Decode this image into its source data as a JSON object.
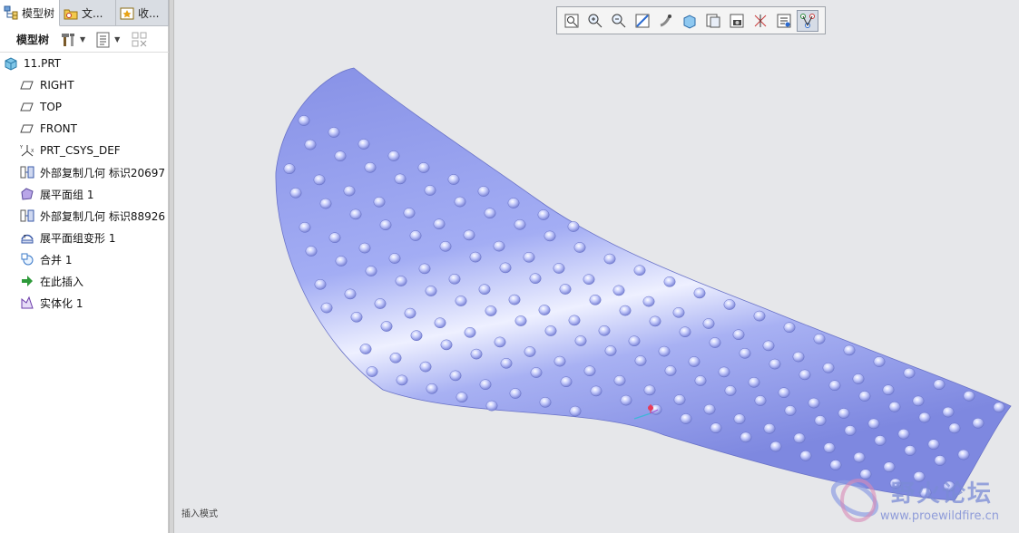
{
  "tabs": [
    {
      "label": "模型树",
      "icon": "model-tree-icon",
      "active": true
    },
    {
      "label": "文...",
      "icon": "folder-browser-icon",
      "active": false
    },
    {
      "label": "收...",
      "icon": "favorites-icon",
      "active": false
    }
  ],
  "tree_toolbar": {
    "label": "模型树",
    "buttons": [
      "settings-hammer-icon",
      "show-list-icon",
      "filter-icon"
    ]
  },
  "tree": {
    "root": "11.PRT",
    "items": [
      {
        "label": "RIGHT",
        "icon": "datum-plane-icon"
      },
      {
        "label": "TOP",
        "icon": "datum-plane-icon"
      },
      {
        "label": "FRONT",
        "icon": "datum-plane-icon"
      },
      {
        "label": "PRT_CSYS_DEF",
        "icon": "csys-icon"
      },
      {
        "label": "外部复制几何 标识20697",
        "icon": "external-copy-geom-icon"
      },
      {
        "label": "展平面组 1",
        "icon": "flatten-quilt-icon"
      },
      {
        "label": "外部复制几何 标识88926",
        "icon": "external-copy-geom-icon"
      },
      {
        "label": "展平面组变形 1",
        "icon": "flatten-quilt-deform-icon"
      },
      {
        "label": "合并 1",
        "icon": "merge-icon"
      },
      {
        "label": "在此插入",
        "icon": "insert-here-arrow-icon"
      },
      {
        "label": "实体化 1",
        "icon": "solidify-icon"
      }
    ]
  },
  "view_toolbar": {
    "buttons": [
      "refit-icon",
      "zoom-in-icon",
      "zoom-out-icon",
      "repaint-icon",
      "spin-center-icon",
      "display-style-icon",
      "saved-views-icon",
      "view-manager-icon",
      "datum-display-icon",
      "annotation-display-icon",
      "perspective-icon"
    ]
  },
  "status": {
    "mode_text": "插入模式"
  },
  "watermark": {
    "title": "野火论坛",
    "url": "www.proewildfire.cn"
  },
  "colors": {
    "model": "#9aa5ef",
    "model_highlight": "#e9ecff",
    "background": "#e6e7ea",
    "accent": "#7b8bd6"
  }
}
